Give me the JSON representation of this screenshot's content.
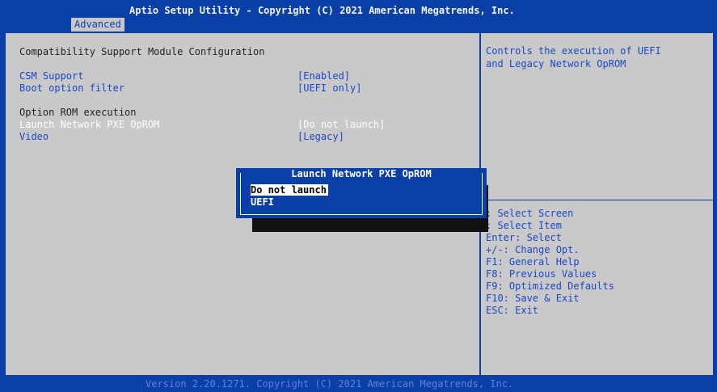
{
  "window": {
    "title": "Aptio Setup Utility - Copyright (C) 2021 American Megatrends, Inc.",
    "active_tab": "Advanced"
  },
  "main": {
    "heading": "Compatibility Support Module Configuration",
    "settings": [
      {
        "label": "CSM Support",
        "value": "[Enabled]"
      },
      {
        "label": "Boot option filter",
        "value": "[UEFI only]"
      }
    ],
    "section": "Option ROM execution",
    "rom_settings": [
      {
        "label": "Launch Network PXE OpROM",
        "value": "[Do not launch]",
        "selected": true
      },
      {
        "label": "Video",
        "value": "[Legacy]"
      }
    ]
  },
  "help": {
    "line1": "Controls the execution of UEFI",
    "line2": "and Legacy Network OpROM",
    "keys": [
      ": Select Screen",
      ": Select Item",
      "Enter: Select",
      "+/-: Change Opt.",
      "F1: General Help",
      "F8: Previous Values",
      "F9: Optimized Defaults",
      "F10: Save & Exit",
      "ESC: Exit"
    ]
  },
  "popup": {
    "title": "Launch Network PXE OpROM",
    "options": [
      "Do not launch",
      "UEFI"
    ],
    "selected_index": 0
  },
  "footer": {
    "text": "Version 2.20.1271. Copyright (C) 2021 American Megatrends, Inc."
  },
  "colors": {
    "background": "#0b3fa8",
    "panel": "#c9c9c9",
    "text_blue": "#1b47c8",
    "selected": "#ffffff"
  }
}
